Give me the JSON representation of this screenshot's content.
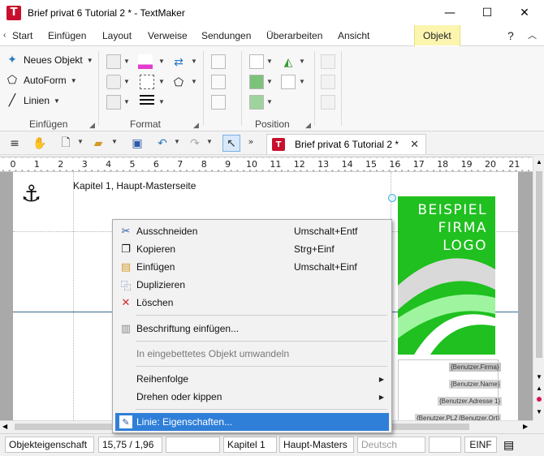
{
  "window": {
    "title": "Brief privat 6 Tutorial 2 * - TextMaker",
    "app_icon": "T",
    "minimize": "—",
    "maximize": "☐",
    "close": "✕"
  },
  "ribbon_tabs": {
    "scroll_left": "‹",
    "items": [
      "Start",
      "Einfügen",
      "Layout",
      "Verweise",
      "Sendungen",
      "Überarbeiten",
      "Ansicht",
      "Objekt"
    ],
    "help": "?",
    "collapse": "︿"
  },
  "ribbon": {
    "einfuegen": {
      "neues_objekt": "Neues Objekt",
      "autoform": "AutoForm",
      "linien": "Linien",
      "label": "Einfügen"
    },
    "format": {
      "label": "Format"
    },
    "position": {
      "label": "Position"
    }
  },
  "quick_toolbar": {
    "document_tab": "Brief privat 6 Tutorial 2 *",
    "doc_tab_close": "✕",
    "more": "»"
  },
  "ruler": {
    "ticks": [
      "0",
      "1",
      "2",
      "3",
      "4",
      "5",
      "6",
      "7",
      "8",
      "9",
      "10",
      "11",
      "12",
      "13",
      "14",
      "15",
      "16",
      "17",
      "18",
      "19",
      "20",
      "21"
    ]
  },
  "document": {
    "header_text": "Kapitel 1, Haupt-Masterseite",
    "logo_text": "BEISPIEL\nFIRMA\nLOGO",
    "fields": [
      "{Benutzer.Firma}",
      "{Benutzer.Name}",
      "{Benutzer.Adresse 1}",
      "{Benutzer.PLZ}",
      "{Benutzer.Ort}"
    ],
    "colors": {
      "logo_green": "#1fc01f",
      "light_green": "#9ff59f"
    }
  },
  "context_menu": {
    "items": [
      {
        "label": "Ausschneiden",
        "shortcut": "Umschalt+Entf",
        "icon": "scissors-icon"
      },
      {
        "label": "Kopieren",
        "shortcut": "Strg+Einf",
        "icon": "copy-icon"
      },
      {
        "label": "Einfügen",
        "shortcut": "Umschalt+Einf",
        "icon": "paste-icon"
      },
      {
        "label": "Duplizieren",
        "shortcut": "",
        "icon": "duplicate-icon"
      },
      {
        "label": "Löschen",
        "shortcut": "",
        "icon": "delete-icon"
      },
      {
        "label": "Beschriftung einfügen...",
        "shortcut": "",
        "icon": "caption-icon"
      },
      {
        "label": "In eingebettetes Objekt umwandeln",
        "shortcut": "",
        "icon": ""
      },
      {
        "label": "Reihenfolge",
        "shortcut": "",
        "icon": ""
      },
      {
        "label": "Drehen oder kippen",
        "shortcut": "",
        "icon": ""
      },
      {
        "label": "Linie: Eigenschaften...",
        "shortcut": "",
        "icon": "line-properties-icon"
      }
    ],
    "submenu_arrow": "▶",
    "highlight_color": "#2f7fd8"
  },
  "statusbar": {
    "mode": "Objekteigenschaft",
    "position": "15,75 / 1,96",
    "field3": "",
    "chapter": "Kapitel 1",
    "master": "Haupt-Masters",
    "language": "Deutsch",
    "field7": "",
    "insert_mode": "EINF"
  }
}
